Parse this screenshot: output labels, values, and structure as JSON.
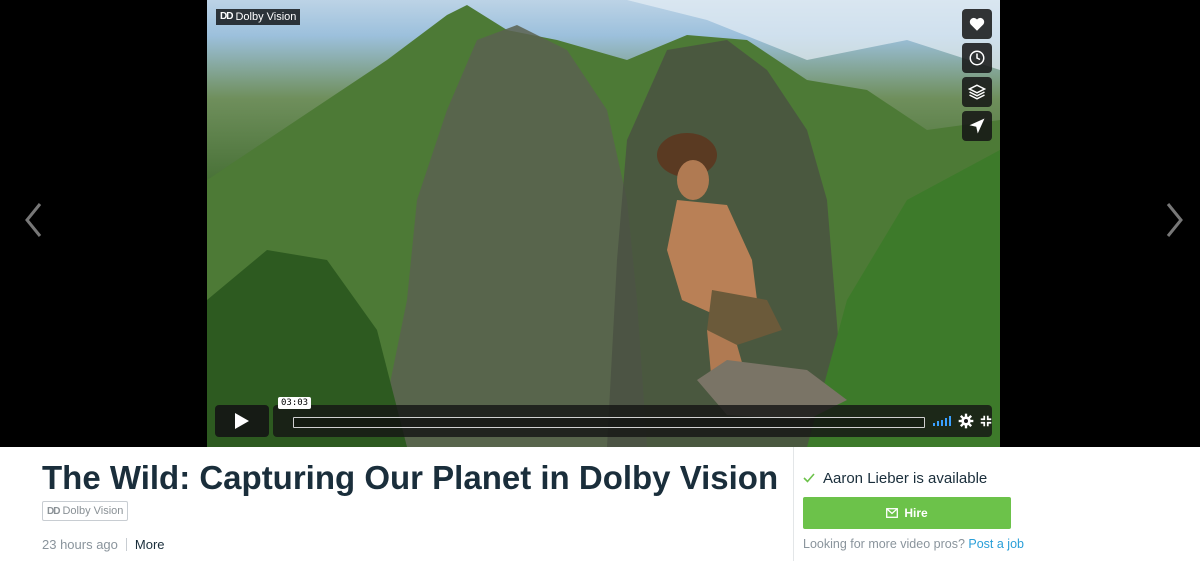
{
  "video": {
    "badge": "Dolby Vision",
    "badge_logo": "DD",
    "time": "03:03",
    "side_actions": [
      "heart-icon",
      "clock-icon",
      "layers-icon",
      "send-icon"
    ]
  },
  "info": {
    "title": "The Wild: Capturing Our Planet in Dolby Vision",
    "badge": "Dolby Vision",
    "badge_logo": "DD",
    "posted": "23 hours ago",
    "more": "More"
  },
  "hire": {
    "available": "Aaron Lieber is available",
    "button": "Hire",
    "prompt": "Looking for more video pros?",
    "link": "Post a job"
  },
  "colors": {
    "accent_green": "#6cc24a",
    "link_blue": "#2a9fd8",
    "title": "#1a2e3b"
  }
}
